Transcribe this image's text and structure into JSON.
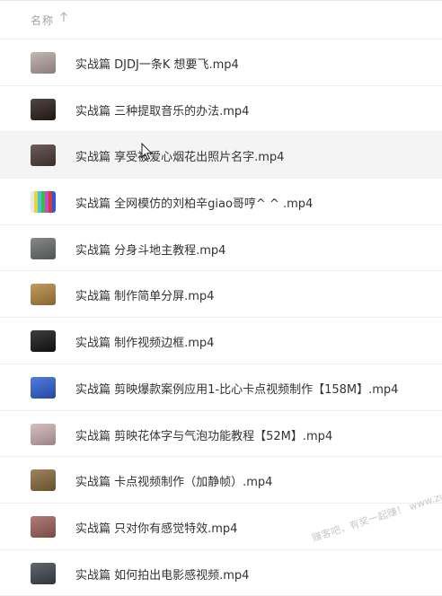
{
  "header": {
    "name_label": "名称",
    "sort_icon": "arrow-up-icon"
  },
  "files": [
    {
      "name": "实战篇 DJDJ一条K 想要飞.mp4",
      "thumb": "#b7a6a4"
    },
    {
      "name": "实战篇 三种提取音乐的办法.mp4",
      "thumb": "#2a1e1b"
    },
    {
      "name": "实战篇 享受被爱心烟花出照片名字.mp4",
      "thumb": "#4d3a36",
      "hovered": true
    },
    {
      "name": "实战篇 全网模仿的刘柏辛giao哥哼^ ^ .mp4",
      "thumb": "#3a6fd8",
      "color_bars": true
    },
    {
      "name": "实战篇 分身斗地主教程.mp4",
      "thumb": "#6b6f6e"
    },
    {
      "name": "实战篇 制作简单分屏.mp4",
      "thumb": "#b4873f"
    },
    {
      "name": "实战篇 制作视频边框.mp4",
      "thumb": "#141414"
    },
    {
      "name": "实战篇 剪映爆款案例应用1-比心卡点视频制作【158M】.mp4",
      "thumb": "#2f5fd7"
    },
    {
      "name": "实战篇 剪映花体字与气泡功能教程【52M】.mp4",
      "thumb": "#cfb0b4"
    },
    {
      "name": "实战篇 卡点视频制作（加静帧）.mp4",
      "thumb": "#8a6a3c"
    },
    {
      "name": "实战篇 只对你有感觉特效.mp4",
      "thumb": "#a0625a"
    },
    {
      "name": "实战篇 如何拍出电影感视频.mp4",
      "thumb": "#3f4650"
    }
  ],
  "watermark": "赚客吧，有奖一起赚！ www.zuanke8.com"
}
